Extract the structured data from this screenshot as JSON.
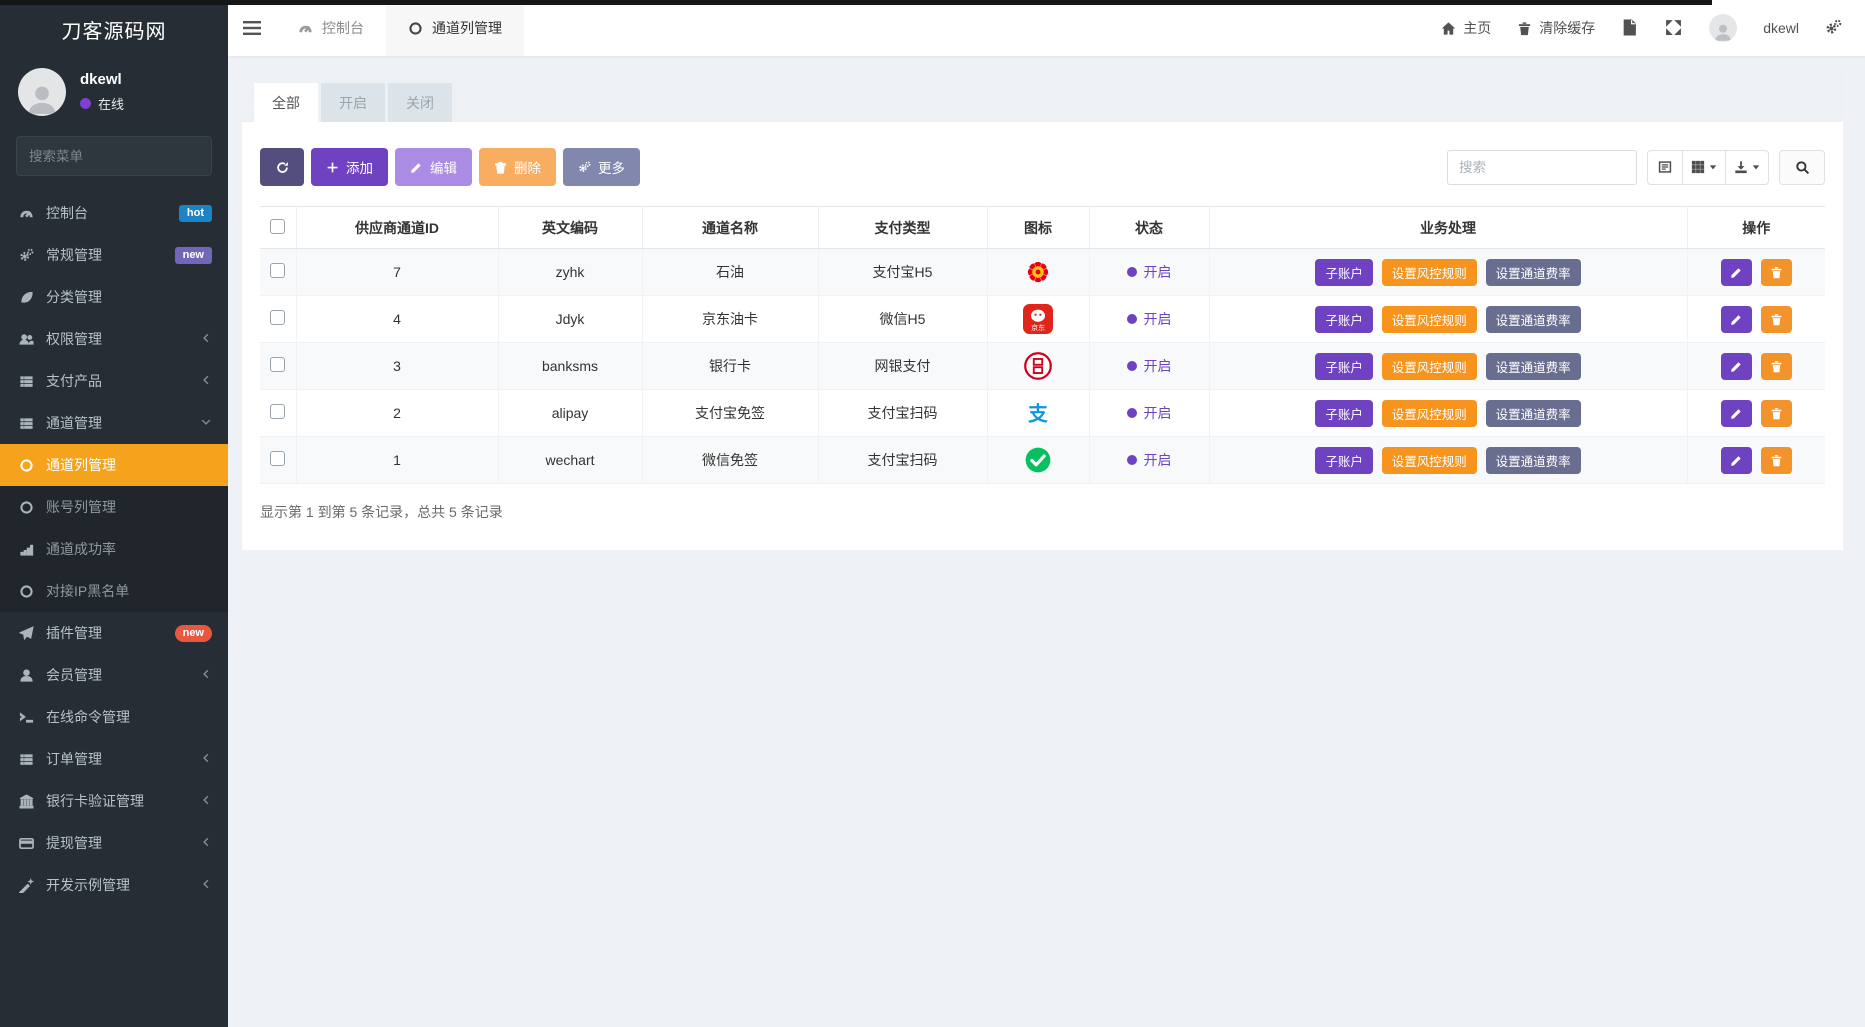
{
  "colors": {
    "accent_purple": "#6f42c1",
    "accent_orange_active_menu": "#f5a31d",
    "badge_hot_blue": "#1c84c6",
    "badge_new_purple": "#7266ba",
    "badge_new_red": "#e9573f",
    "status_open_purple": "#6f42c1",
    "sidebar_bg": "#262d34"
  },
  "sidebar": {
    "logo": "刀客源码网",
    "user": {
      "name": "dkewl",
      "status_label": "在线"
    },
    "search_placeholder": "搜索菜单",
    "menu": [
      {
        "label": "控制台",
        "badge": "hot"
      },
      {
        "label": "常规管理",
        "badge": "new"
      },
      {
        "label": "分类管理"
      },
      {
        "label": "权限管理"
      },
      {
        "label": "支付产品"
      },
      {
        "label": "通道管理"
      },
      {
        "label": "通道列管理"
      },
      {
        "label": "账号列管理"
      },
      {
        "label": "通道成功率"
      },
      {
        "label": "对接IP黑名单"
      },
      {
        "label": "插件管理",
        "badge": "new"
      },
      {
        "label": "会员管理"
      },
      {
        "label": "在线命令管理"
      },
      {
        "label": "订单管理"
      },
      {
        "label": "银行卡验证管理"
      },
      {
        "label": "提现管理"
      },
      {
        "label": "开发示例管理"
      }
    ]
  },
  "topbar": {
    "tab_console": "控制台",
    "tab_channel": "通道列管理",
    "home": "主页",
    "clear_cache": "清除缓存",
    "username": "dkewl"
  },
  "panel": {
    "tabs": {
      "all": "全部",
      "open": "开启",
      "closed": "关闭"
    },
    "toolbar": {
      "add": "添加",
      "edit": "编辑",
      "delete": "删除",
      "more": "更多",
      "search_placeholder": "搜索"
    }
  },
  "table": {
    "headers": {
      "id": "供应商通道ID",
      "code": "英文编码",
      "name": "通道名称",
      "pay_type": "支付类型",
      "icon": "图标",
      "status": "状态",
      "business": "业务处理",
      "actions": "操作"
    },
    "biz": {
      "sub_account": "子账户",
      "risk_rule": "设置风控规则",
      "channel_rate": "设置通道费率"
    },
    "rows": [
      {
        "id": "7",
        "code": "zyhk",
        "name": "石油",
        "pay_type": "支付宝H5",
        "icon": "petrochina",
        "status": "开启"
      },
      {
        "id": "4",
        "code": "Jdyk",
        "name": "京东油卡",
        "pay_type": "微信H5",
        "icon": "jd",
        "status": "开启"
      },
      {
        "id": "3",
        "code": "banksms",
        "name": "银行卡",
        "pay_type": "网银支付",
        "icon": "bank",
        "status": "开启"
      },
      {
        "id": "2",
        "code": "alipay",
        "name": "支付宝免签",
        "pay_type": "支付宝扫码",
        "icon": "alipay",
        "status": "开启"
      },
      {
        "id": "1",
        "code": "wechart",
        "name": "微信免签",
        "pay_type": "支付宝扫码",
        "icon": "wechat",
        "status": "开启"
      }
    ],
    "summary": "显示第 1 到第 5 条记录，总共 5 条记录"
  }
}
